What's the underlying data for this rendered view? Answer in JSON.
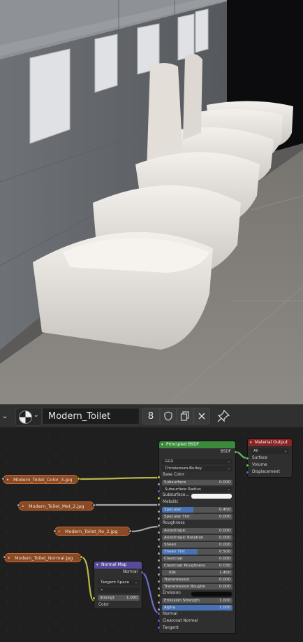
{
  "header": {
    "dropdown_chevron": "⌄",
    "material_name": "Modern_Toilet",
    "user_count": "8",
    "icons": [
      "material-sphere-icon",
      "fake-user-shield-icon",
      "duplicate-icon",
      "close-icon",
      "pin-icon"
    ]
  },
  "image_nodes": [
    {
      "label": "Modern_Toilet_Color_3.jpg"
    },
    {
      "label": "Modern_Toilet_Met_2.jpg"
    },
    {
      "label": "Modern_Toilet_Ro_2.jpg"
    },
    {
      "label": "Modern_Toilet_Normal.jpg"
    }
  ],
  "normal_map": {
    "title": "Normal Map",
    "output": "Normal",
    "space": "Tangent Space",
    "uv": "•",
    "strength_label": "Strengt",
    "strength_value": "1.000",
    "color_label": "Color"
  },
  "bsdf": {
    "title": "Principled BSDF",
    "output": "BSDF",
    "distribution": "GGX",
    "subsurface_method": "Christensen-Burley",
    "rows": {
      "base_color": "Base Color",
      "subsurface": {
        "label": "Subsurface",
        "value": "0.000"
      },
      "subsurface_radius": "Subsurface Radius",
      "subsurface_color": "Subsurface...",
      "metallic": "Metallic",
      "specular": {
        "label": "Specular",
        "value": "0.450"
      },
      "specular_tint": {
        "label": "Specular Tint",
        "value": "0.000"
      },
      "roughness": "Roughness",
      "anisotropic": {
        "label": "Anisotropic",
        "value": "0.000"
      },
      "anisotropic_rotation": {
        "label": "Anisotropic Rotation",
        "value": "0.000"
      },
      "sheen": {
        "label": "Sheen",
        "value": "0.000"
      },
      "sheen_tint": {
        "label": "Sheen Tint",
        "value": "0.500"
      },
      "clearcoat": {
        "label": "Clearcoat",
        "value": "0.000"
      },
      "clearcoat_roughness": {
        "label": "Clearcoat Roughness",
        "value": "0.030"
      },
      "ior": {
        "label": "IOR",
        "value": "1.450"
      },
      "transmission": {
        "label": "Transmission",
        "value": "0.000"
      },
      "transmission_roughness": {
        "label": "Transmission Roughn",
        "value": "0.000"
      },
      "emission": "Emission",
      "emission_strength": {
        "label": "Emission Strength",
        "value": "1.000"
      },
      "alpha": {
        "label": "Alpha",
        "value": "1.000"
      },
      "normal": "Normal",
      "clearcoat_normal": "Clearcoat Normal",
      "tangent": "Tangent"
    }
  },
  "material_output": {
    "title": "Material Output",
    "target": "All",
    "surface": "Surface",
    "volume": "Volume",
    "displacement": "Displacement"
  },
  "colors": {
    "shader_header": "#3b8a3b",
    "output_header": "#8c2424",
    "vector_header": "#5a4a9c",
    "image_node": "#8a4a24",
    "accent_blue": "#4772b3"
  }
}
